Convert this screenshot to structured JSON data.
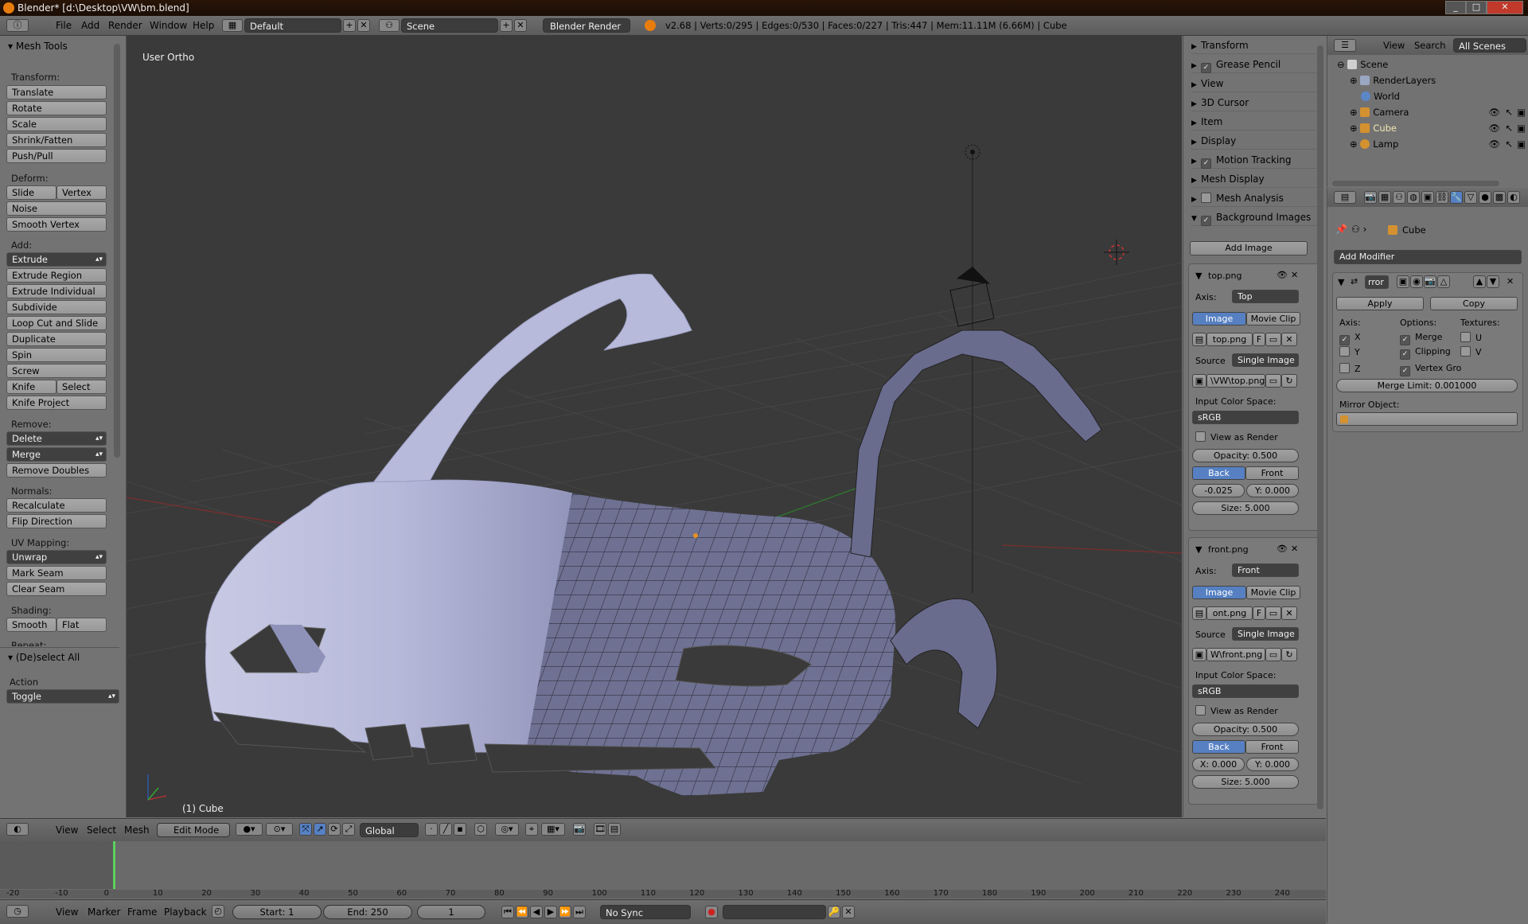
{
  "window": {
    "title": "Blender* [d:\\Desktop\\VW\\bm.blend]",
    "buttons": [
      "_",
      "□",
      "✕"
    ]
  },
  "infobar": {
    "menus": [
      "File",
      "Add",
      "Render",
      "Window",
      "Help"
    ],
    "layout": "Default",
    "scene": "Scene",
    "engine": "Blender Render",
    "stats": "v2.68 | Verts:0/295 | Edges:0/530 | Faces:0/227 | Tris:447 | Mem:11.11M (6.66M) | Cube"
  },
  "toolshelf": {
    "title": "Mesh Tools",
    "transform_label": "Transform:",
    "transform": [
      "Translate",
      "Rotate",
      "Scale",
      "Shrink/Fatten",
      "Push/Pull"
    ],
    "deform_label": "Deform:",
    "deform_pair": [
      "Slide Edge",
      "Vertex"
    ],
    "deform": [
      "Noise",
      "Smooth Vertex"
    ],
    "add_label": "Add:",
    "add_dropdown": "Extrude",
    "add": [
      "Extrude Region",
      "Extrude Individual",
      "Subdivide",
      "Loop Cut and Slide",
      "Duplicate",
      "Spin",
      "Screw"
    ],
    "add_pair": [
      "Knife",
      "Select"
    ],
    "add_last": "Knife Project",
    "remove_label": "Remove:",
    "remove_dropdowns": [
      "Delete",
      "Merge"
    ],
    "remove": "Remove Doubles",
    "normals_label": "Normals:",
    "normals": [
      "Recalculate",
      "Flip Direction"
    ],
    "uv_label": "UV Mapping:",
    "uv_dropdown": "Unwrap",
    "uv": [
      "Mark Seam",
      "Clear Seam"
    ],
    "shading_label": "Shading:",
    "shading_pair": [
      "Smooth",
      "Flat"
    ],
    "repeat_label": "Repeat:",
    "operator_title": "(De)select All",
    "action_label": "Action",
    "action_value": "Toggle"
  },
  "viewport": {
    "view_label": "User Ortho",
    "object_label": "(1) Cube"
  },
  "npanel": {
    "headers": [
      {
        "label": "Transform",
        "check": false
      },
      {
        "label": "Grease Pencil",
        "check": true
      },
      {
        "label": "View",
        "check": false
      },
      {
        "label": "3D Cursor",
        "check": false
      },
      {
        "label": "Item",
        "check": false
      },
      {
        "label": "Display",
        "check": false
      },
      {
        "label": "Motion Tracking",
        "check": true
      },
      {
        "label": "Mesh Display",
        "check": false
      },
      {
        "label": "Mesh Analysis",
        "check": true
      },
      {
        "label": "Background Images",
        "check": true
      }
    ],
    "add_image": "Add Image",
    "images": [
      {
        "name": "top.png",
        "axis": "Top",
        "file": "top.png",
        "file_flag": "F",
        "source": "Single Image",
        "path": "\\VW\\top.png",
        "colorspace": "sRGB",
        "x": "-0.025",
        "y": "Y: 0.000",
        "opacity": "Opacity: 0.500",
        "size": "Size: 5.000"
      },
      {
        "name": "front.png",
        "axis": "Front",
        "file": "ont.png",
        "file_flag": "F",
        "source": "Single Image",
        "path": "W\\front.png",
        "colorspace": "sRGB",
        "x": "X: 0.000",
        "y": "Y: 0.000",
        "opacity": "Opacity: 0.500",
        "size": "Size: 5.000"
      }
    ],
    "axis_label": "Axis:",
    "image_tab": "Image",
    "movieclip_tab": "Movie Clip",
    "source_label": "Source",
    "colorspace_label": "Input Color Space:",
    "view_as_render": "View as Render",
    "back": "Back",
    "front": "Front"
  },
  "outliner": {
    "menus": [
      "View",
      "Search"
    ],
    "filter": "All Scenes",
    "rows": [
      {
        "label": "Scene",
        "indent": 0,
        "color": "#cfcfcf"
      },
      {
        "label": "RenderLayers",
        "indent": 1,
        "color": "#9aa7c2"
      },
      {
        "label": "World",
        "indent": 1,
        "color": "#5b87c7"
      },
      {
        "label": "Camera",
        "indent": 1,
        "color": "#d4912f"
      },
      {
        "label": "Cube",
        "indent": 1,
        "color": "#d4912f"
      },
      {
        "label": "Lamp",
        "indent": 1,
        "color": "#d4912f"
      }
    ]
  },
  "properties": {
    "object": "Cube",
    "add_modifier": "Add Modifier",
    "modifier_name": "rror",
    "apply": "Apply",
    "copy": "Copy",
    "axis_label": "Axis:",
    "options_label": "Options:",
    "textures_label": "Textures:",
    "axis": [
      "X",
      "Y",
      "Z"
    ],
    "options": [
      "Merge",
      "Clipping",
      "Vertex Gro"
    ],
    "textures": [
      "U",
      "V"
    ],
    "merge_limit": "Merge Limit: 0.001000",
    "mirror_object": "Mirror Object:"
  },
  "vp_header": {
    "menus": [
      "View",
      "Select",
      "Mesh"
    ],
    "mode": "Edit Mode",
    "orientation": "Global"
  },
  "timeline": {
    "ticks": [
      "-20",
      "-10",
      "0",
      "10",
      "20",
      "30",
      "40",
      "50",
      "60",
      "70",
      "80",
      "90",
      "100",
      "110",
      "120",
      "130",
      "140",
      "150",
      "160",
      "170",
      "180",
      "190",
      "200",
      "210",
      "220",
      "230",
      "240"
    ],
    "current_frame_value": 1,
    "menus": [
      "View",
      "Marker",
      "Frame",
      "Playback"
    ],
    "start": "Start: 1",
    "end": "End: 250",
    "frame": "1",
    "sync": "No Sync"
  }
}
